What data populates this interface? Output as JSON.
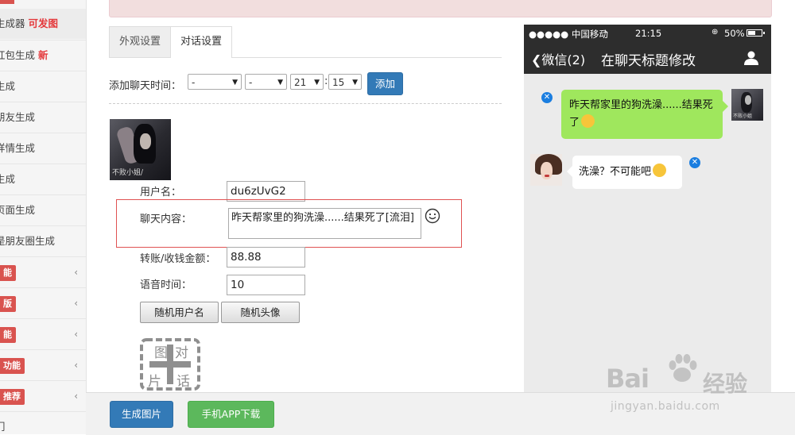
{
  "sidebar": {
    "items": [
      {
        "label": "生成器",
        "hot": "可发图"
      },
      {
        "label": "红包生成",
        "hot": "新"
      },
      {
        "label": "生成",
        "hot": ""
      },
      {
        "label": "朋友生成",
        "hot": ""
      },
      {
        "label": "详情生成",
        "hot": ""
      },
      {
        "label": "生成",
        "hot": ""
      },
      {
        "label": "页面生成",
        "hot": ""
      },
      {
        "label": "是朋友圈生成",
        "hot": ""
      }
    ],
    "groups": [
      {
        "badge": "能"
      },
      {
        "badge": "版"
      },
      {
        "badge": "能"
      },
      {
        "badge": "功能"
      },
      {
        "badge": "推荐"
      }
    ],
    "chevron": "‹",
    "last_item": "门"
  },
  "tabs": [
    {
      "label": "外观设置",
      "active": false
    },
    {
      "label": "对话设置",
      "active": true
    }
  ],
  "time_row": {
    "label": "添加聊天时间：",
    "selects": [
      "-",
      "-",
      "21",
      "15"
    ],
    "colon": ":",
    "add_button": "添加"
  },
  "form": {
    "avatar_caption": "不败小姐/",
    "username_label": "用户名：",
    "username_value": "du6zUvG2",
    "content_label": "聊天内容：",
    "content_value": "昨天帮家里的狗洗澡......结果死了[流泪]",
    "amount_label": "转账/收钱金额：",
    "amount_value": "88.88",
    "voice_label": "语音时间：",
    "voice_value": "10",
    "random_name_button": "随机用户名",
    "random_avatar_button": "随机头像",
    "image_dialog_chars": [
      "图",
      "对",
      "片",
      "话"
    ]
  },
  "bottom": {
    "generate_button": "生成图片",
    "app_button": "手机APP下载"
  },
  "phone": {
    "carrier": "●●●●● 中国移动",
    "time": "21:15",
    "battery": "50%",
    "back_label": "微信(2)",
    "title": "在聊天标题修改",
    "message_right": "昨天帮家里的狗洗澡......结果死了",
    "message_left": "洗澡？不可能吧",
    "avatar_caption": "不败小姐"
  },
  "watermark": {
    "brand": "Bai",
    "cn": "经验",
    "url": "jingyan.baidu.com"
  },
  "colors": {
    "primary": "#337ab7",
    "success": "#5cb85c",
    "danger": "#d9534f",
    "wechat_green": "#9fe75d",
    "wechat_dark": "#2d2d2d"
  }
}
